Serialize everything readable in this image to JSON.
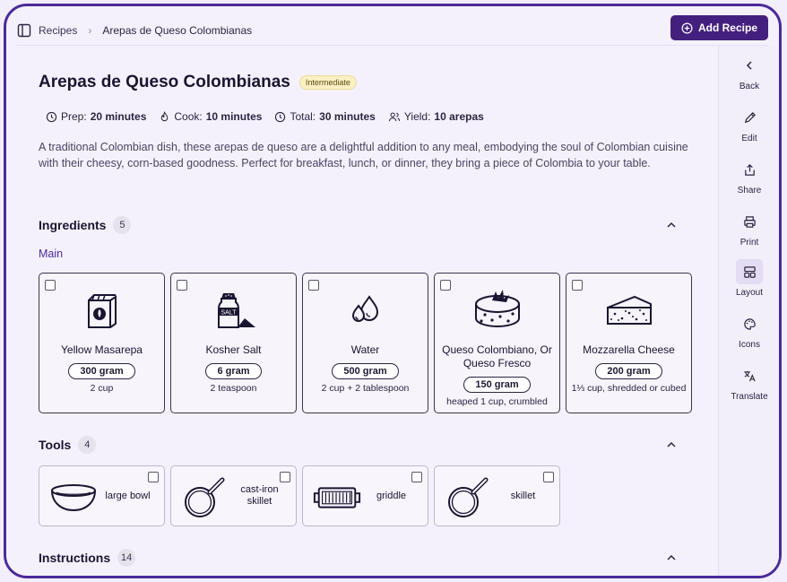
{
  "breadcrumb": {
    "root": "Recipes",
    "current": "Arepas de Queso Colombianas"
  },
  "header": {
    "add_label": "Add Recipe"
  },
  "recipe": {
    "title": "Arepas de Queso Colombianas",
    "difficulty": "Intermediate",
    "prep_label": "Prep:",
    "prep_value": "20 minutes",
    "cook_label": "Cook:",
    "cook_value": "10 minutes",
    "total_label": "Total:",
    "total_value": "30 minutes",
    "yield_label": "Yield:",
    "yield_value": "10 arepas",
    "description": "A traditional Colombian dish, these arepas de queso are a delightful addition to any meal, embodying the soul of Colombian cuisine with their cheesy, corn-based goodness. Perfect for breakfast, lunch, or dinner, they bring a piece of Colombia to your table."
  },
  "ingredients": {
    "title": "Ingredients",
    "count": "5",
    "group": "Main",
    "items": [
      {
        "name": "Yellow Masarepa",
        "amount": "300 gram",
        "note": "2 cup",
        "icon": "masarepa-bag-icon"
      },
      {
        "name": "Kosher Salt",
        "amount": "6 gram",
        "note": "2 teaspoon",
        "icon": "salt-shaker-icon",
        "icon_text": "SALT"
      },
      {
        "name": "Water",
        "amount": "500 gram",
        "note": "2 cup + 2 tablespoon",
        "icon": "water-drops-icon"
      },
      {
        "name": "Queso Colombiano, Or Queso Fresco",
        "amount": "150 gram",
        "note": "heaped 1 cup, crumbled",
        "icon": "cheese-wheel-icon"
      },
      {
        "name": "Mozzarella Cheese",
        "amount": "200 gram",
        "note": "1⅓ cup, shredded or cubed",
        "icon": "cheese-wedge-icon"
      }
    ]
  },
  "tools": {
    "title": "Tools",
    "count": "4",
    "items": [
      {
        "name": "large bowl",
        "icon": "bowl-icon"
      },
      {
        "name": "cast-iron skillet",
        "icon": "skillet-icon"
      },
      {
        "name": "griddle",
        "icon": "griddle-icon"
      },
      {
        "name": "skillet",
        "icon": "skillet-icon"
      }
    ]
  },
  "instructions": {
    "title": "Instructions",
    "count": "14"
  },
  "sidebar": {
    "back": "Back",
    "edit": "Edit",
    "share": "Share",
    "print": "Print",
    "layout": "Layout",
    "icons": "Icons",
    "translate": "Translate"
  }
}
